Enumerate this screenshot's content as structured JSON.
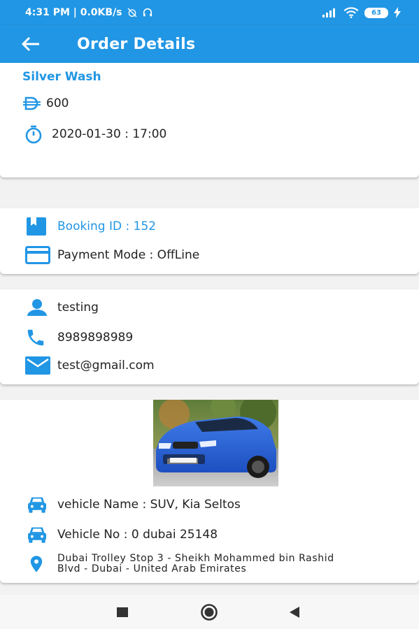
{
  "status_bar": {
    "time_net": "4:31 PM | 0.0KB/s",
    "battery": "63",
    "icons": [
      "alarm-off-icon",
      "headset-icon",
      "signal-icon",
      "wifi-icon",
      "battery-icon",
      "charging-icon"
    ]
  },
  "app_bar": {
    "title": "Order Details",
    "back_icon": "arrow-back-icon",
    "color": "#2196e4"
  },
  "service": {
    "name": "Silver Wash",
    "price": "600",
    "currency_icon": "dirham-icon",
    "datetime": "2020-01-30 : 17:00",
    "datetime_icon": "timer-icon"
  },
  "booking": {
    "booking_id": "Booking ID : 152",
    "payment_mode": "Payment Mode : OffLine"
  },
  "customer": {
    "name": "testing",
    "phone": "8989898989",
    "email": "test@gmail.com"
  },
  "vehicle": {
    "name": "vehicle Name : SUV, Kia Seltos",
    "number": "Vehicle No : 0 dubai 25148",
    "address_line1": "Dubai Trolley Stop 3 - Sheikh Mohammed bin Rashid",
    "address_line2": "Blvd - Dubai - United Arab Emirates"
  },
  "nav_bar": {
    "buttons": [
      "recents-button",
      "home-button",
      "back-button"
    ]
  }
}
